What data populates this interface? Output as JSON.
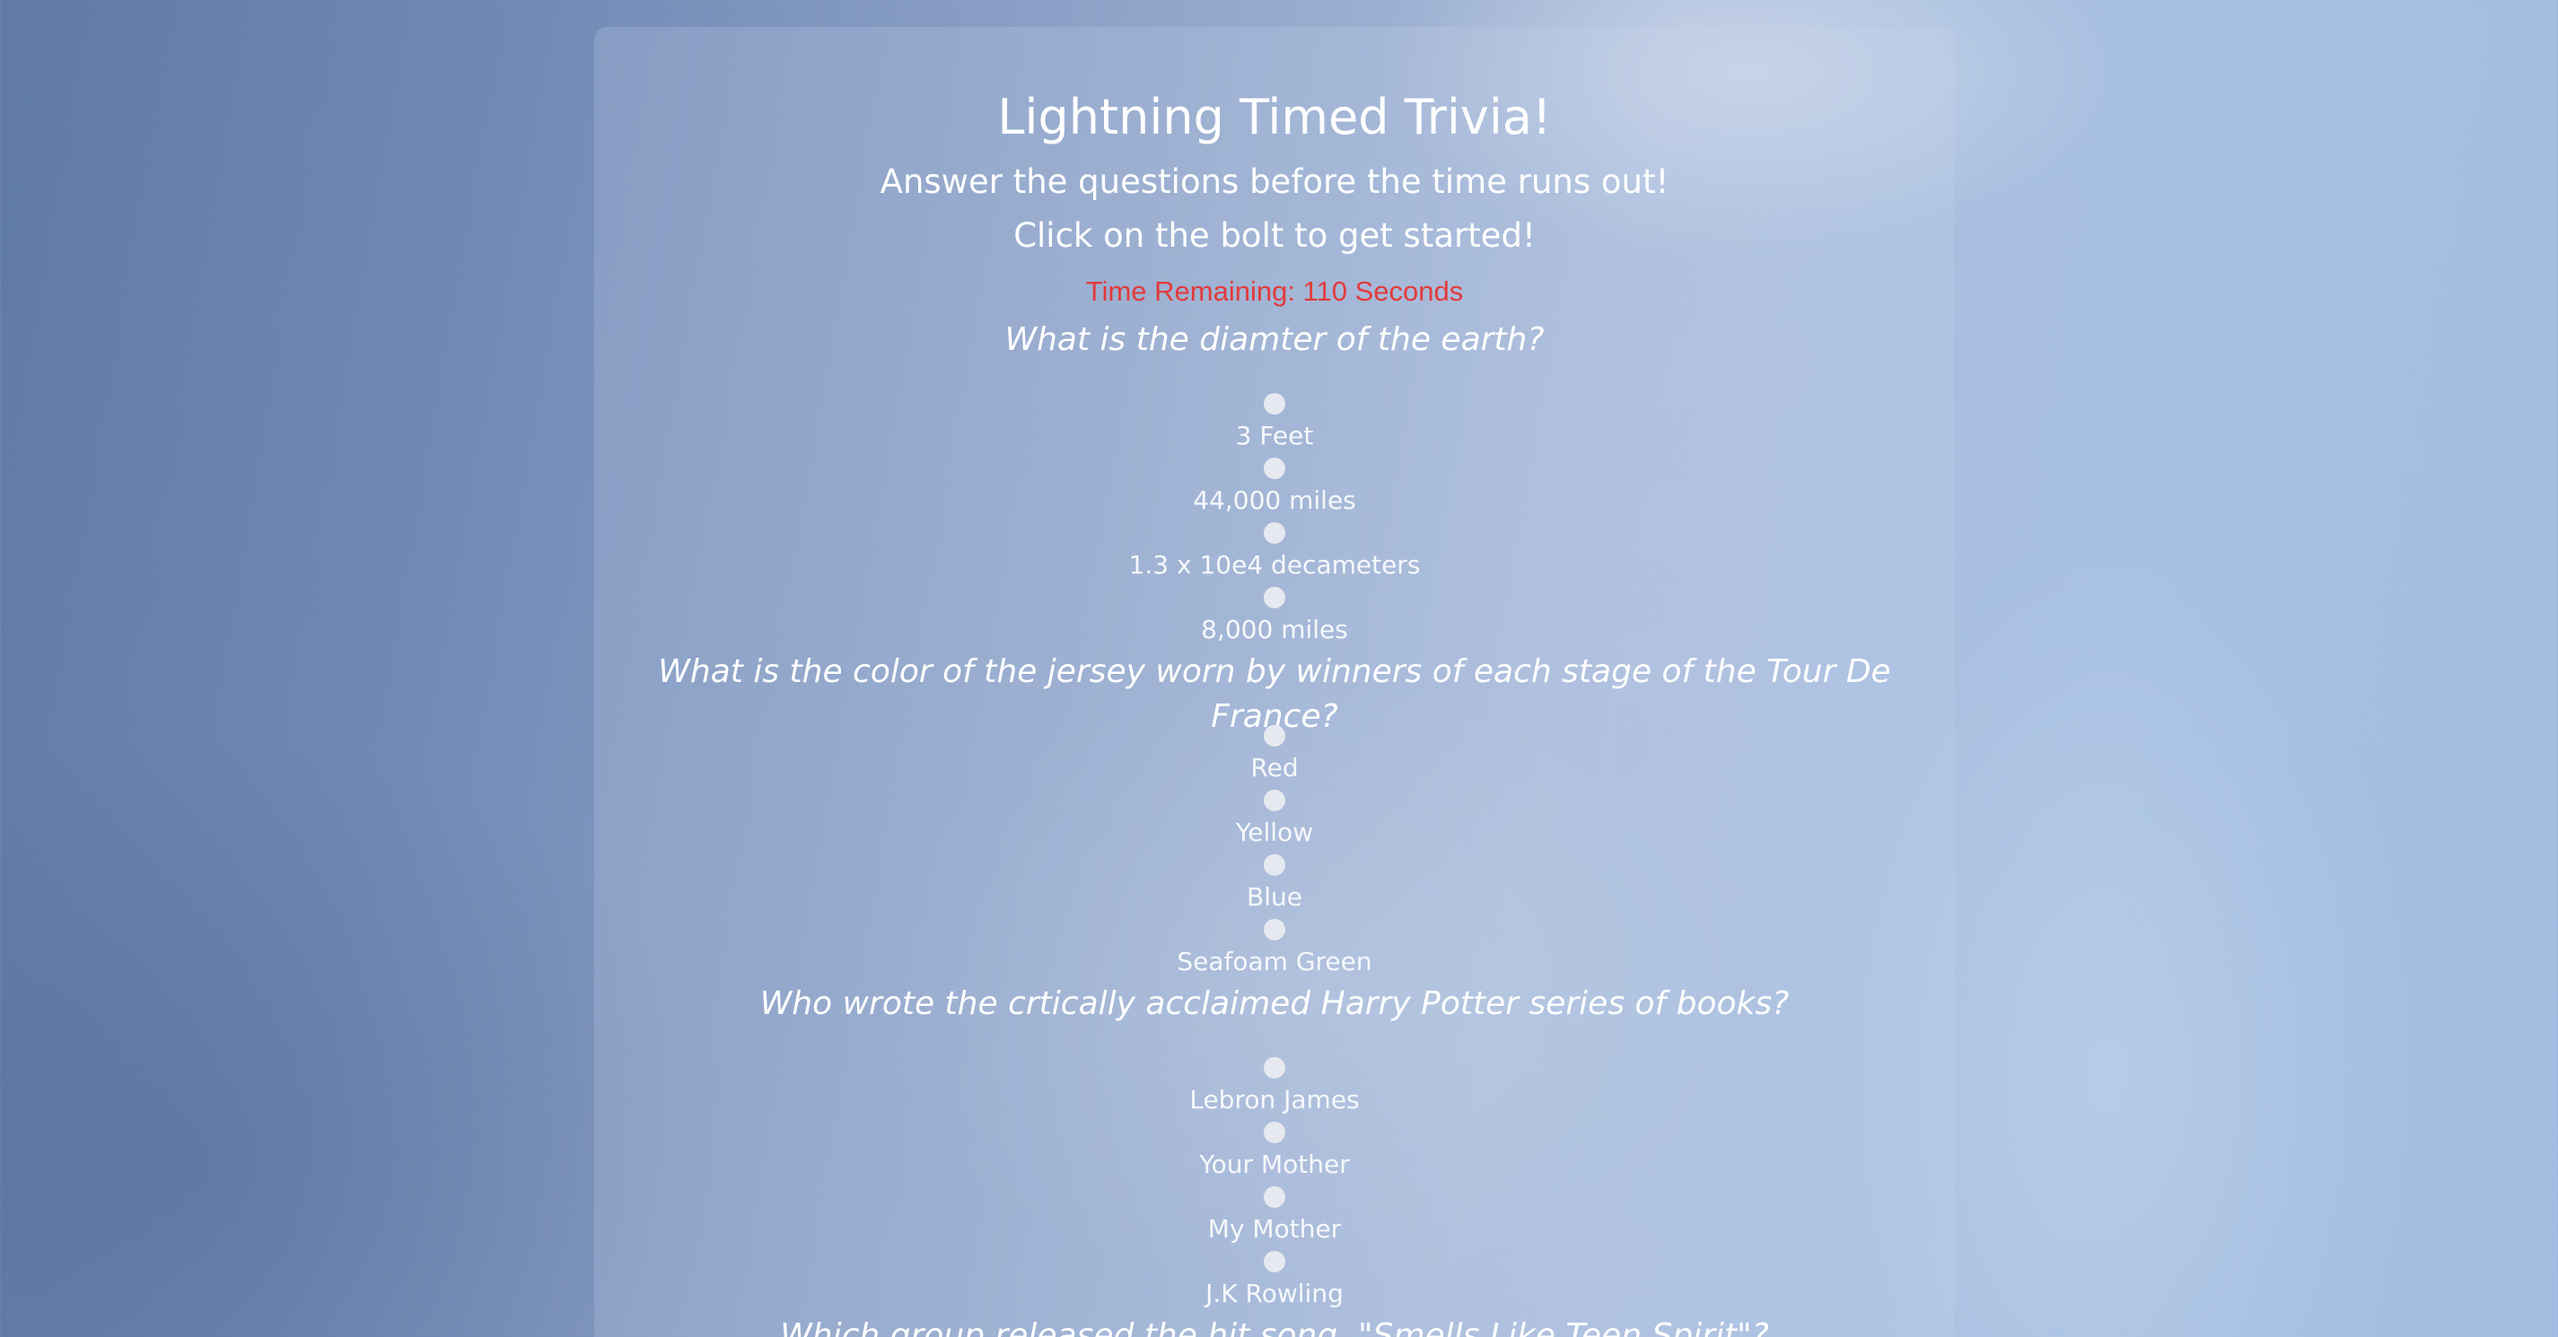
{
  "page": {
    "title": "Lightning Timed Trivia!",
    "subtitle_1": "Answer the questions before the time runs out!",
    "subtitle_2": "Click on the bolt to get started!",
    "timer_text": "Time Remaining: 110 Seconds"
  },
  "colors": {
    "timer": "#e23b3b",
    "text": "#ffffff",
    "radio": "#e6e9ef"
  },
  "questions": [
    {
      "text": "What is the diamter of the earth?",
      "options": [
        "3 Feet",
        "44,000 miles",
        "1.3 x 10e4 decameters",
        "8,000 miles"
      ]
    },
    {
      "text": "What is the color of the jersey worn by winners of each stage of the Tour De France?",
      "options": [
        "Red",
        "Yellow",
        "Blue",
        "Seafoam Green"
      ]
    },
    {
      "text": "Who wrote the crtically acclaimed Harry Potter series of books?",
      "options": [
        "Lebron James",
        "Your Mother",
        "My Mother",
        "J.K Rowling"
      ]
    },
    {
      "text": "Which group released the hit song, \"Smells Like Teen Spirit\"?",
      "options": []
    }
  ]
}
